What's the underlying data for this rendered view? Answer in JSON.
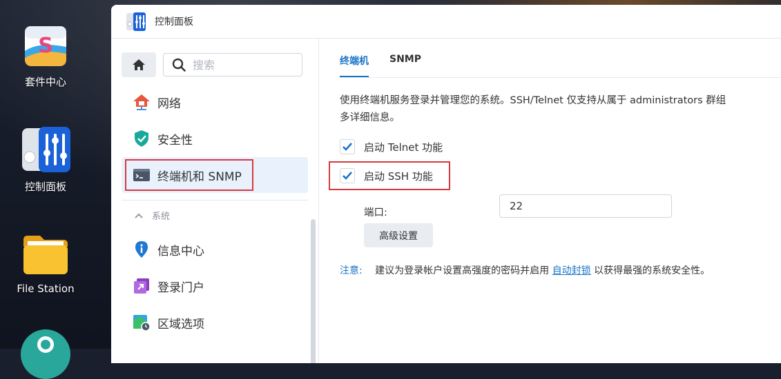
{
  "desktop": {
    "icons": [
      {
        "label": "套件中心"
      },
      {
        "label": "控制面板"
      },
      {
        "label": "File Station"
      }
    ]
  },
  "window": {
    "title": "控制面板"
  },
  "sidebar": {
    "search_placeholder": "搜索",
    "items": [
      {
        "label": "网络",
        "icon": "house-network-icon"
      },
      {
        "label": "安全性",
        "icon": "shield-check-icon"
      },
      {
        "label": "终端机和 SNMP",
        "icon": "terminal-icon",
        "active": true
      }
    ],
    "section": {
      "label": "系统"
    },
    "system_items": [
      {
        "label": "信息中心",
        "icon": "info-icon"
      },
      {
        "label": "登录门户",
        "icon": "portal-icon"
      },
      {
        "label": "区域选项",
        "icon": "region-icon"
      }
    ]
  },
  "main": {
    "tabs": [
      {
        "label": "终端机",
        "active": true
      },
      {
        "label": "SNMP",
        "active": false
      }
    ],
    "description_line1": "使用终端机服务登录并管理您的系统。SSH/Telnet 仅支持从属于 administrators 群组",
    "description_line2": "多详细信息。",
    "telnet": {
      "label": "启动 Telnet 功能",
      "checked": true
    },
    "ssh": {
      "label": "启动 SSH 功能",
      "checked": true
    },
    "port": {
      "label": "端口:",
      "value": "22"
    },
    "advanced_button": "高级设置",
    "note": {
      "tag": "注意:",
      "text_before": "建议为登录帐户设置高强度的密码并启用",
      "link": "自动封锁",
      "text_after": "以获得最强的系统安全性。"
    }
  },
  "colors": {
    "accent": "#1a73c8",
    "highlight_box": "#d9363e",
    "active_bg": "#e8f1fc"
  }
}
